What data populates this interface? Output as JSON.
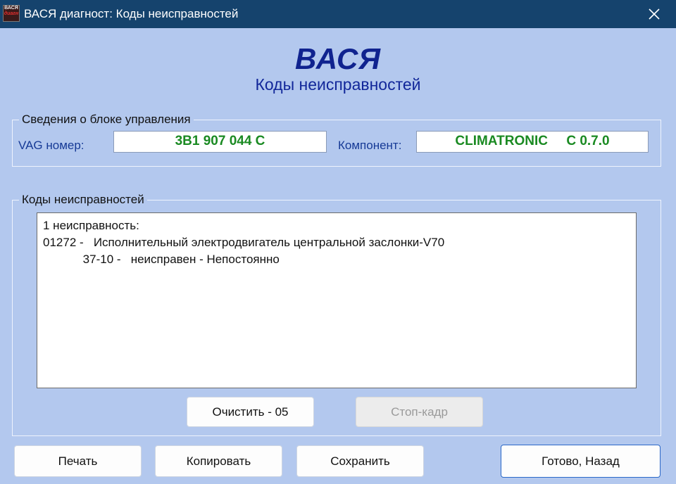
{
  "window": {
    "title": "ВАСЯ диагност: Коды неисправностей",
    "icon_text_top": "ВАСЯ",
    "icon_text_bottom": "диагн"
  },
  "header": {
    "brand": "ВАСЯ",
    "subtitle": "Коды неисправностей"
  },
  "control_unit": {
    "legend": "Сведения о блоке управления",
    "vag_label": "VAG номер:",
    "vag_value": "3B1 907 044 C",
    "component_label": "Компонент:",
    "component_value": "CLIMATRONIC     C 0.7.0"
  },
  "fault_codes": {
    "legend": "Коды неисправностей",
    "lines": [
      "1 неисправность:",
      "01272 -   Исполнительный электродвигатель центральной заслонки-V70",
      "            37-10 -   неисправен - Непостоянно"
    ],
    "clear_button": "Очистить - 05",
    "freeze_frame_button": "Стоп-кадр"
  },
  "footer": {
    "print_button": "Печать",
    "copy_button": "Копировать",
    "save_button": "Сохранить",
    "done_button": "Готово, Назад"
  },
  "colors": {
    "titlebar": "#15436d",
    "background": "#b3c8ee",
    "brand": "#10238f",
    "field_value": "#1a8a22"
  },
  "icons": {
    "close": "close-icon",
    "app": "app-icon"
  }
}
